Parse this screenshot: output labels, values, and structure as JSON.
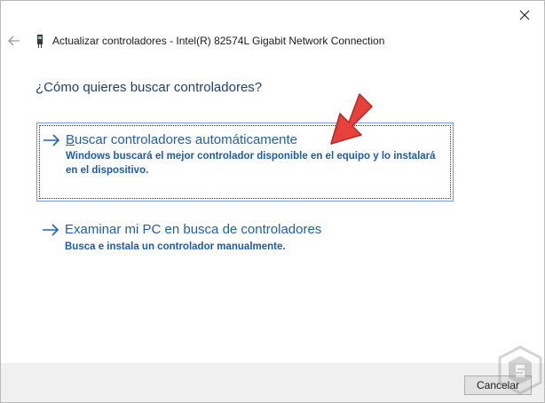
{
  "window": {
    "title": "Actualizar controladores - Intel(R) 82574L Gigabit Network Connection"
  },
  "question": "¿Cómo quieres buscar controladores?",
  "options": [
    {
      "title_access": "B",
      "title_rest": "uscar controladores automáticamente",
      "description": "Windows buscará el mejor controlador disponible en el equipo y lo instalará en el dispositivo."
    },
    {
      "title_access": "",
      "title_rest": "Examinar mi PC en busca de controladores",
      "description": "Busca e instala un controlador manualmente."
    }
  ],
  "footer": {
    "cancel_label": "Cancelar"
  },
  "colors": {
    "link_blue": "#1e5eb5",
    "annotation_red": "#e8403a"
  },
  "icons": {
    "close": "close-icon",
    "back": "back-arrow-icon",
    "device": "network-adapter-icon",
    "option_arrow": "arrow-right-icon",
    "annotation": "red-pointer-arrow-icon",
    "watermark": "site-logo-icon"
  }
}
